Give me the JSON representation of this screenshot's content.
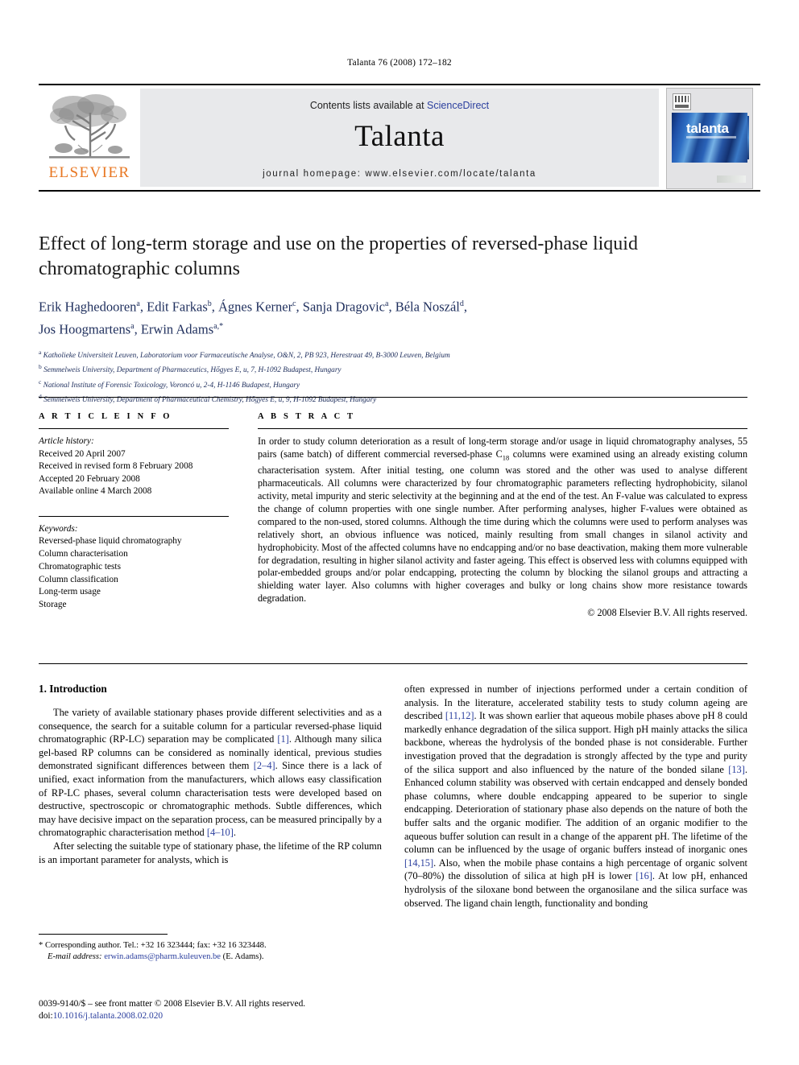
{
  "running_head": "Talanta 76 (2008) 172–182",
  "masthead": {
    "contents_prefix": "Contents lists available at ",
    "sciencedirect": "ScienceDirect",
    "journal_title": "Talanta",
    "homepage": "journal homepage: www.elsevier.com/locate/talanta",
    "publisher_wordmark": "ELSEVIER",
    "cover_title": "talanta",
    "accent_orange": "#E87722",
    "link_blue": "#2b3f9e"
  },
  "article": {
    "title": "Effect of long-term storage and use on the properties of reversed-phase liquid chromatographic columns",
    "authors_line_1": "Erik Haghedooren",
    "authors_html_line1": "Erik Haghedooren a, Edit Farkas b, Ágnes Kerner c, Sanja Dragovic a, Béla Noszál d,",
    "authors_html_line2": "Jos Hoogmartens a, Erwin Adams a,*",
    "affiliations": [
      "a Katholieke Universiteit Leuven, Laboratorium voor Farmaceutische Analyse, O&N, 2, PB 923, Herestraat 49, B-3000 Leuven, Belgium",
      "b Semmelweis University, Department of Pharmaceutics, Hőgyes E, u, 7, H-1092 Budapest, Hungary",
      "c National Institute of Forensic Toxicology, Voroncó u, 2-4, H-1146 Budapest, Hungary",
      "d Semmelweis University, Department of Pharmaceutical Chemistry, Hőgyes E, u, 9, H-1092 Budapest, Hungary"
    ]
  },
  "article_info": {
    "heading": "A R T I C L E   I N F O",
    "history_label": "Article history:",
    "history": [
      "Received 20 April 2007",
      "Received in revised form 8 February 2008",
      "Accepted 20 February 2008",
      "Available online 4 March 2008"
    ],
    "keywords_label": "Keywords:",
    "keywords": [
      "Reversed-phase liquid chromatography",
      "Column characterisation",
      "Chromatographic tests",
      "Column classification",
      "Long-term usage",
      "Storage"
    ]
  },
  "abstract": {
    "heading": "A B S T R A C T",
    "part1": "In order to study column deterioration as a result of long-term storage and/or usage in liquid chromatography analyses, 55 pairs (same batch) of different commercial reversed-phase C",
    "sub": "18",
    "part2": " columns were examined using an already existing column characterisation system. After initial testing, one column was stored and the other was used to analyse different pharmaceuticals. All columns were characterized by four chromatographic parameters reflecting hydrophobicity, silanol activity, metal impurity and steric selectivity at the beginning and at the end of the test. An F-value was calculated to express the change of column properties with one single number. After performing analyses, higher F-values were obtained as compared to the non-used, stored columns. Although the time during which the columns were used to perform analyses was relatively short, an obvious influence was noticed, mainly resulting from small changes in silanol activity and hydrophobicity. Most of the affected columns have no endcapping and/or no base deactivation, making them more vulnerable for degradation, resulting in higher silanol activity and faster ageing. This effect is observed less with columns equipped with polar-embedded groups and/or polar endcapping, protecting the column by blocking the silanol groups and attracting a shielding water layer. Also columns with higher coverages and bulky or long chains show more resistance towards degradation.",
    "copyright": "© 2008 Elsevier B.V. All rights reserved."
  },
  "introduction": {
    "heading": "1.  Introduction",
    "left_p1_a": "The variety of available stationary phases provide different selectivities and as a consequence, the search for a suitable column for a particular reversed-phase liquid chromatographic (RP-LC) separation may be complicated ",
    "ref1": "[1]",
    "left_p1_b": ". Although many silica gel-based RP columns can be considered as nominally identical, previous studies demonstrated significant differences between them ",
    "ref2": "[2–4]",
    "left_p1_c": ". Since there is a lack of unified, exact information from the manufacturers, which allows easy classification of RP-LC phases, several column characterisation tests were developed based on destructive, spectroscopic or chromatographic methods. Subtle differences, which may have decisive impact on the separation process, can be measured principally by a chromatographic characterisation method ",
    "ref3": "[4–10]",
    "left_p1_d": ".",
    "left_p2": "After selecting the suitable type of stationary phase, the lifetime of the RP column is an important parameter for analysts, which is",
    "right_p1_a": "often expressed in number of injections performed under a certain condition of analysis. In the literature, accelerated stability tests to study column ageing are described ",
    "ref4": "[11,12]",
    "right_p1_b": ". It was shown earlier that aqueous mobile phases above pH 8 could markedly enhance degradation of the silica support. High pH mainly attacks the silica backbone, whereas the hydrolysis of the bonded phase is not considerable. Further investigation proved that the degradation is strongly affected by the type and purity of the silica support and also influenced by the nature of the bonded silane ",
    "ref5": "[13]",
    "right_p1_c": ". Enhanced column stability was observed with certain endcapped and densely bonded phase columns, where double endcapping appeared to be superior to single endcapping. Deterioration of stationary phase also depends on the nature of both the buffer salts and the organic modifier. The addition of an organic modifier to the aqueous buffer solution can result in a change of the apparent pH. The lifetime of the column can be influenced by the usage of organic buffers instead of inorganic ones ",
    "ref6": "[14,15]",
    "right_p1_d": ". Also, when the mobile phase contains a high percentage of organic solvent (70–80%) the dissolution of silica at high pH is lower ",
    "ref7": "[16]",
    "right_p1_e": ". At low pH, enhanced hydrolysis of the siloxane bond between the organosilane and the silica surface was observed. The ligand chain length, functionality and bonding"
  },
  "footnotes": {
    "corresponding": "* Corresponding author. Tel.: +32 16 323444; fax: +32 16 323448.",
    "email_label": "E-mail address:",
    "email": "erwin.adams@pharm.kuleuven.be",
    "email_suffix": " (E. Adams).",
    "issn_line": "0039-9140/$ – see front matter © 2008 Elsevier B.V. All rights reserved.",
    "doi_label": "doi:",
    "doi": "10.1016/j.talanta.2008.02.020"
  }
}
